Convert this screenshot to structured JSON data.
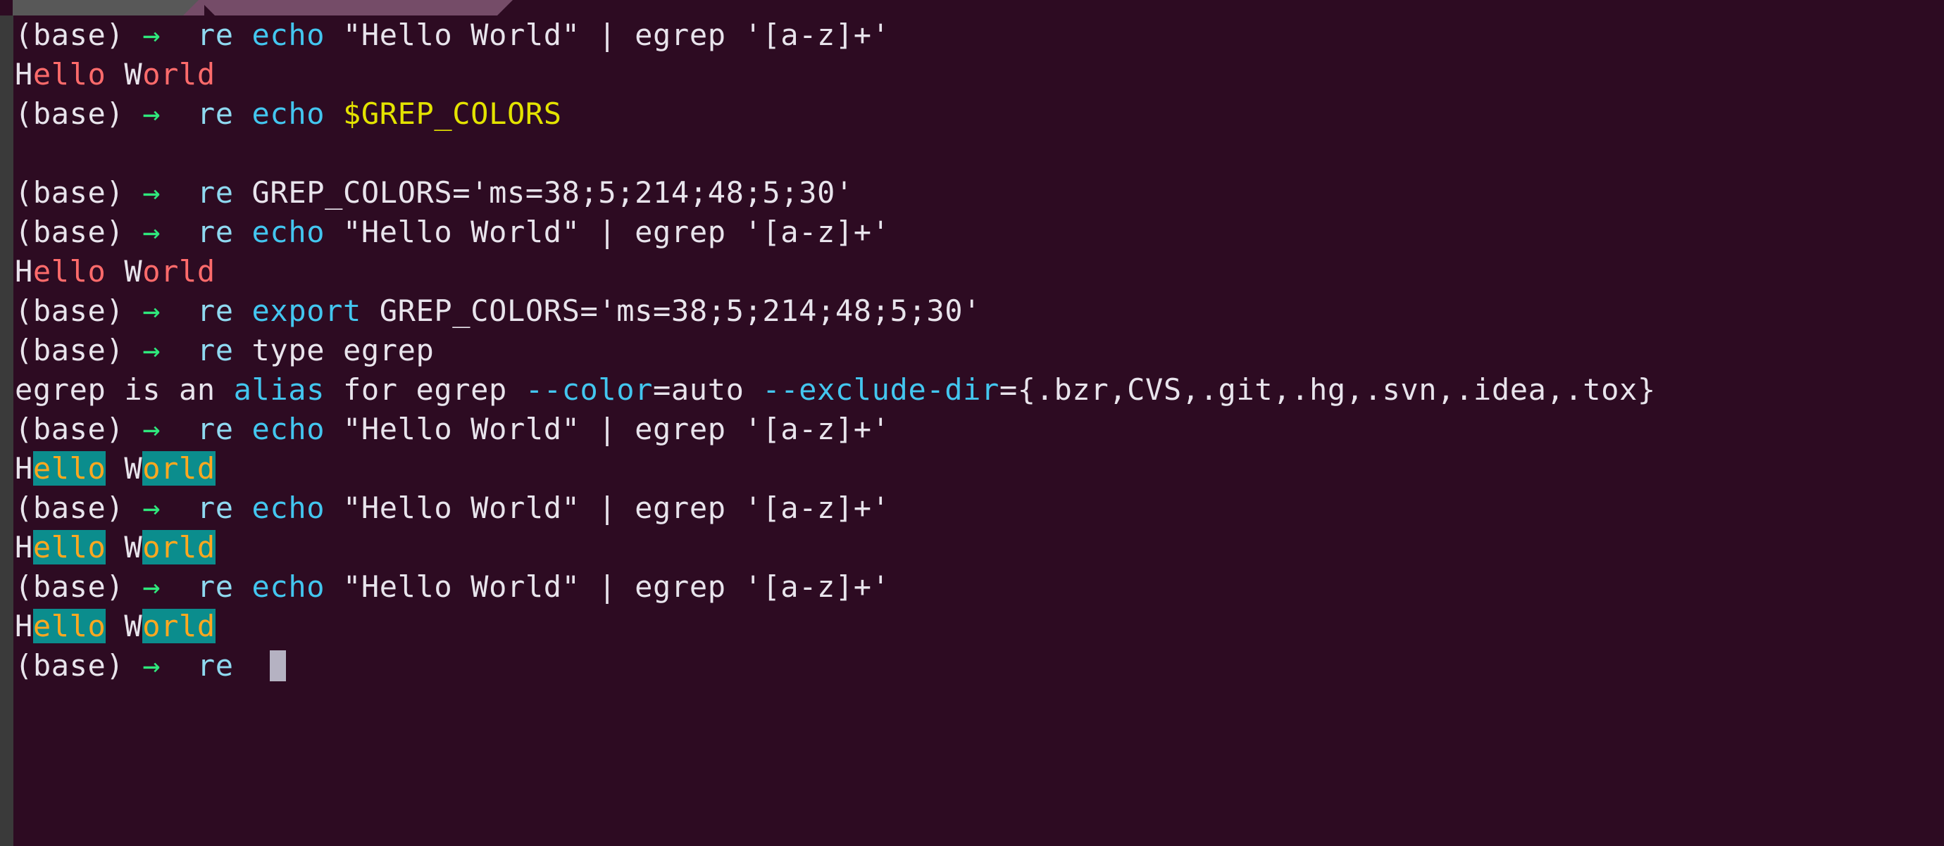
{
  "window": {
    "tabs": [
      {
        "name": "tab-inactive",
        "label": "",
        "active": false
      },
      {
        "name": "tab-active",
        "label": "",
        "active": true
      }
    ],
    "colors": {
      "background": "#2d0b22",
      "gutter": "#3a3a3a",
      "tab_inactive": "#585858",
      "tab_active": "#754c68",
      "prompt_arrow": "#2fe87c",
      "builtin_cyan": "#43c6ef",
      "command_pale_blue": "#8fd9f0",
      "variable_yellow": "#e3e300",
      "grep_default_red": "#ff6b6b",
      "grep_custom_match_bg": "#0b8d8d",
      "grep_custom_match_fg": "#ffa81f",
      "foreground_white": "#e8e4ec",
      "cursor": "#b5b2c2"
    }
  },
  "terminal": {
    "prompt": {
      "env": "(base)",
      "arrow": "→",
      "user": "re"
    },
    "lines": [
      {
        "id": "line-1",
        "kind": "prompt",
        "segments": [
          {
            "text": "(base) ",
            "color": "white"
          },
          {
            "text": "→",
            "color": "green"
          },
          {
            "text": "  ",
            "color": "white"
          },
          {
            "text": "re ",
            "color": "pale"
          },
          {
            "text": "echo",
            "color": "cyan"
          },
          {
            "text": " \"Hello World\" | egrep '[a-z]+'",
            "color": "white"
          }
        ]
      },
      {
        "id": "line-2",
        "kind": "output",
        "segments": [
          {
            "text": "H",
            "color": "white"
          },
          {
            "text": "ello",
            "color": "red"
          },
          {
            "text": " W",
            "color": "white"
          },
          {
            "text": "orld",
            "color": "red"
          }
        ]
      },
      {
        "id": "line-3",
        "kind": "prompt",
        "segments": [
          {
            "text": "(base) ",
            "color": "white"
          },
          {
            "text": "→",
            "color": "green"
          },
          {
            "text": "  ",
            "color": "white"
          },
          {
            "text": "re ",
            "color": "pale"
          },
          {
            "text": "echo",
            "color": "cyan"
          },
          {
            "text": " ",
            "color": "white"
          },
          {
            "text": "$GREP_COLORS",
            "color": "yellow"
          }
        ]
      },
      {
        "id": "line-4",
        "kind": "output",
        "segments": [
          {
            "text": "",
            "color": "white"
          }
        ]
      },
      {
        "id": "line-5",
        "kind": "prompt",
        "segments": [
          {
            "text": "(base) ",
            "color": "white"
          },
          {
            "text": "→",
            "color": "green"
          },
          {
            "text": "  ",
            "color": "white"
          },
          {
            "text": "re ",
            "color": "pale"
          },
          {
            "text": "GREP_COLORS='ms=38;5;214;48;5;30'",
            "color": "white"
          }
        ]
      },
      {
        "id": "line-6",
        "kind": "prompt",
        "segments": [
          {
            "text": "(base) ",
            "color": "white"
          },
          {
            "text": "→",
            "color": "green"
          },
          {
            "text": "  ",
            "color": "white"
          },
          {
            "text": "re ",
            "color": "pale"
          },
          {
            "text": "echo",
            "color": "cyan"
          },
          {
            "text": " \"Hello World\" | egrep '[a-z]+'",
            "color": "white"
          }
        ]
      },
      {
        "id": "line-7",
        "kind": "output",
        "segments": [
          {
            "text": "H",
            "color": "white"
          },
          {
            "text": "ello",
            "color": "red"
          },
          {
            "text": " W",
            "color": "white"
          },
          {
            "text": "orld",
            "color": "red"
          }
        ]
      },
      {
        "id": "line-8",
        "kind": "prompt",
        "segments": [
          {
            "text": "(base) ",
            "color": "white"
          },
          {
            "text": "→",
            "color": "green"
          },
          {
            "text": "  ",
            "color": "white"
          },
          {
            "text": "re ",
            "color": "pale"
          },
          {
            "text": "export",
            "color": "cyan"
          },
          {
            "text": " GREP_COLORS='ms=38;5;214;48;5;30'",
            "color": "white"
          }
        ]
      },
      {
        "id": "line-9",
        "kind": "prompt",
        "segments": [
          {
            "text": "(base) ",
            "color": "white"
          },
          {
            "text": "→",
            "color": "green"
          },
          {
            "text": "  ",
            "color": "white"
          },
          {
            "text": "re ",
            "color": "pale"
          },
          {
            "text": "type egrep",
            "color": "white"
          }
        ]
      },
      {
        "id": "line-10",
        "kind": "output",
        "segments": [
          {
            "text": "egrep is an ",
            "color": "white"
          },
          {
            "text": "alias",
            "color": "cyan"
          },
          {
            "text": " for egrep ",
            "color": "white"
          },
          {
            "text": "--color",
            "color": "cyan"
          },
          {
            "text": "=auto ",
            "color": "white"
          },
          {
            "text": "--exclude-dir",
            "color": "cyan"
          },
          {
            "text": "={.bzr,CVS,.git,.hg,.svn,.idea,.tox}",
            "color": "white"
          }
        ]
      },
      {
        "id": "line-11",
        "kind": "prompt",
        "segments": [
          {
            "text": "(base) ",
            "color": "white"
          },
          {
            "text": "→",
            "color": "green"
          },
          {
            "text": "  ",
            "color": "white"
          },
          {
            "text": "re ",
            "color": "pale"
          },
          {
            "text": "echo",
            "color": "cyan"
          },
          {
            "text": " \"Hello World\" | egrep '[a-z]+'",
            "color": "white"
          }
        ]
      },
      {
        "id": "line-12",
        "kind": "output",
        "segments": [
          {
            "text": "H",
            "color": "white"
          },
          {
            "text": "ello",
            "color": "hl"
          },
          {
            "text": " W",
            "color": "white"
          },
          {
            "text": "orld",
            "color": "hl"
          }
        ]
      },
      {
        "id": "line-13",
        "kind": "prompt",
        "segments": [
          {
            "text": "(base) ",
            "color": "white"
          },
          {
            "text": "→",
            "color": "green"
          },
          {
            "text": "  ",
            "color": "white"
          },
          {
            "text": "re ",
            "color": "pale"
          },
          {
            "text": "echo",
            "color": "cyan"
          },
          {
            "text": " \"Hello World\" | egrep '[a-z]+'",
            "color": "white"
          }
        ]
      },
      {
        "id": "line-14",
        "kind": "output",
        "segments": [
          {
            "text": "H",
            "color": "white"
          },
          {
            "text": "ello",
            "color": "hl"
          },
          {
            "text": " W",
            "color": "white"
          },
          {
            "text": "orld",
            "color": "hl"
          }
        ]
      },
      {
        "id": "line-15",
        "kind": "prompt",
        "segments": [
          {
            "text": "(base) ",
            "color": "white"
          },
          {
            "text": "→",
            "color": "green"
          },
          {
            "text": "  ",
            "color": "white"
          },
          {
            "text": "re ",
            "color": "pale"
          },
          {
            "text": "echo",
            "color": "cyan"
          },
          {
            "text": " \"Hello World\" | egrep '[a-z]+'",
            "color": "white"
          }
        ]
      },
      {
        "id": "line-16",
        "kind": "output",
        "segments": [
          {
            "text": "H",
            "color": "white"
          },
          {
            "text": "ello",
            "color": "hl"
          },
          {
            "text": " W",
            "color": "white"
          },
          {
            "text": "orld",
            "color": "hl"
          }
        ]
      },
      {
        "id": "line-17",
        "kind": "prompt-active",
        "segments": [
          {
            "text": "(base) ",
            "color": "white"
          },
          {
            "text": "→",
            "color": "green"
          },
          {
            "text": "  ",
            "color": "white"
          },
          {
            "text": "re ",
            "color": "pale"
          },
          {
            "text": " ",
            "color": "white"
          }
        ],
        "cursor": true
      }
    ]
  }
}
